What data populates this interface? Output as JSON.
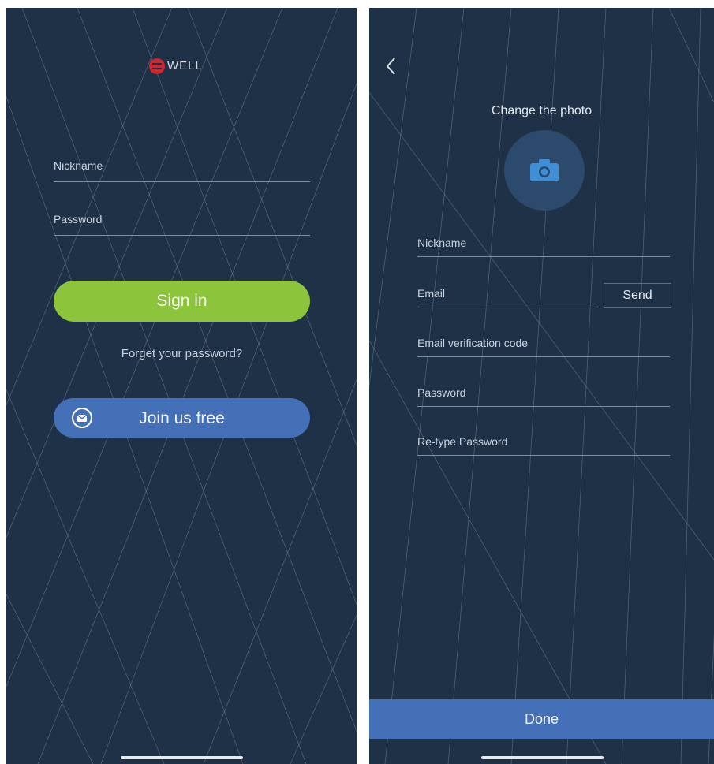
{
  "colors": {
    "background": "#1f3147",
    "accent_green": "#8cc43c",
    "accent_blue": "#4470b8",
    "logo_red": "#d2262e"
  },
  "login": {
    "logo_text": "WELL",
    "nickname_placeholder": "Nickname",
    "password_placeholder": "Password",
    "sign_in_label": "Sign in",
    "forgot_label": "Forget your password?",
    "join_label": "Join us free",
    "join_icon": "mail-icon"
  },
  "register": {
    "back_icon": "chevron-left-icon",
    "photo_label": "Change the photo",
    "photo_icon": "camera-icon",
    "nickname_placeholder": "Nickname",
    "email_placeholder": "Email",
    "send_label": "Send",
    "code_placeholder": "Email verification code",
    "password_placeholder": "Password",
    "retype_placeholder": "Re-type Password",
    "done_label": "Done"
  }
}
